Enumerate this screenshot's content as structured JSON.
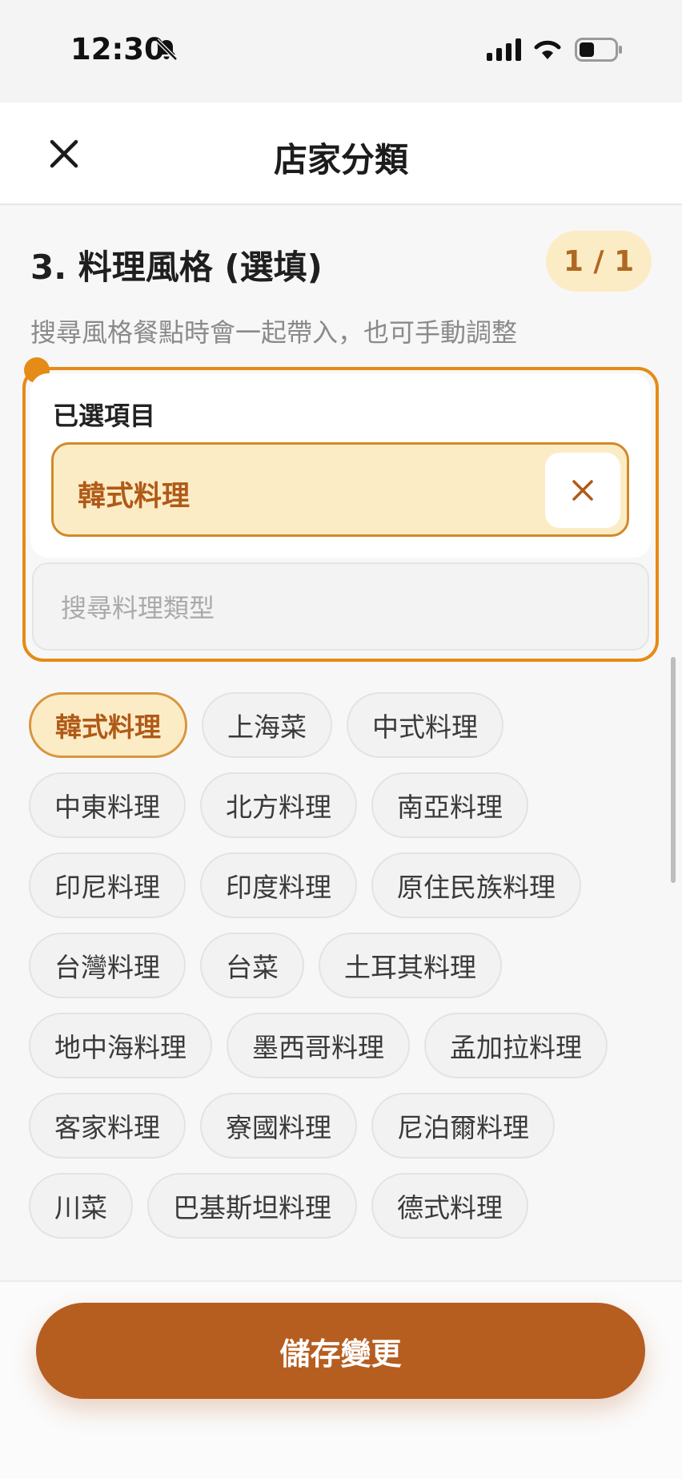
{
  "status_bar": {
    "time": "12:30",
    "icons": [
      "bell-slash-icon",
      "signal-icon",
      "wifi-icon",
      "battery-icon"
    ]
  },
  "header": {
    "title": "店家分類",
    "close_icon": "close-icon"
  },
  "section": {
    "title": "3. 料理風格 (選填)",
    "step": "1 / 1",
    "subtitle": "搜尋風格餐點時會一起帶入，也可手動調整"
  },
  "selected": {
    "label": "已選項目",
    "items": [
      "韓式料理"
    ]
  },
  "search": {
    "placeholder": "搜尋料理類型"
  },
  "chips": {
    "rows": [
      [
        "韓式料理",
        "上海菜",
        "中式料理"
      ],
      [
        "中東料理",
        "北方料理",
        "南亞料理"
      ],
      [
        "印尼料理",
        "印度料理",
        "原住民族料理"
      ],
      [
        "台灣料理",
        "台菜",
        "土耳其料理"
      ],
      [
        "地中海料理",
        "墨西哥料理",
        "孟加拉料理"
      ],
      [
        "客家料理",
        "寮國料理",
        "尼泊爾料理"
      ],
      [
        "川菜",
        "巴基斯坦料理",
        "德式料理"
      ]
    ],
    "active": "韓式料理"
  },
  "footer": {
    "save_label": "儲存變更"
  },
  "colors": {
    "accent": "#e58b17",
    "primary_button": "#b65d20",
    "chip_selected_bg": "#fcecc6"
  }
}
